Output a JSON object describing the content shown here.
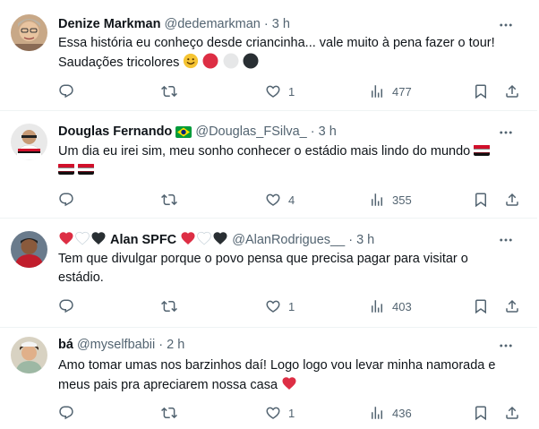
{
  "tweets": [
    {
      "name": "Denize Markman",
      "handle": "@dedemarkman",
      "separator": "·",
      "time": "3 h",
      "text_line1": "Essa história eu conheço desde criancinha... vale muito à pena fazer o tour!",
      "text_line2": "Saudações tricolores",
      "replies": "",
      "retweets": "",
      "likes": "1",
      "views": "477"
    },
    {
      "name": "Douglas Fernando",
      "handle": "@Douglas_FSilva_",
      "separator": "·",
      "time": "3 h",
      "text_line1": "Um dia eu irei sim, meu sonho conhecer o estádio mais lindo do mundo",
      "replies": "",
      "retweets": "",
      "likes": "4",
      "views": "355"
    },
    {
      "name": "Alan SPFC",
      "handle": "@AlanRodrigues__",
      "separator": "·",
      "time": "3 h",
      "text_line1": "Tem que divulgar porque o povo pensa que precisa pagar para visitar o",
      "text_line2": "estádio.",
      "replies": "",
      "retweets": "",
      "likes": "1",
      "views": "403"
    },
    {
      "name": "bá",
      "handle": "@myselfbabii",
      "separator": "·",
      "time": "2 h",
      "text_line1": "Amo tomar umas nos barzinhos daí! Logo logo vou levar minha namorada e",
      "text_line2": "meus pais pra apreciarem nossa casa",
      "replies": "",
      "retweets": "",
      "likes": "1",
      "views": "436"
    }
  ],
  "icons": {
    "reply": "reply-icon",
    "retweet": "retweet-icon",
    "like": "like-icon",
    "views": "views-icon",
    "bookmark": "bookmark-icon",
    "share": "share-icon",
    "more": "more-icon"
  },
  "colors": {
    "text": "#0f1419",
    "muted": "#536471",
    "divider": "#eff3f4",
    "heart_red": "#e0245e"
  }
}
